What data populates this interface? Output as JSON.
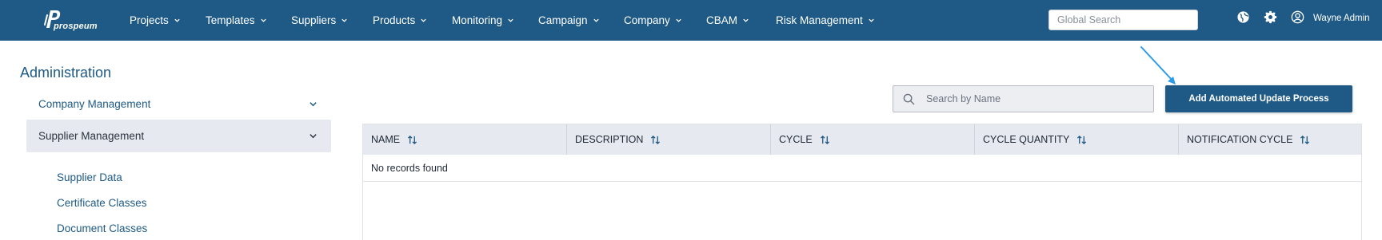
{
  "app": {
    "logo_text": "prospeum"
  },
  "nav": {
    "items": [
      {
        "label": "Projects"
      },
      {
        "label": "Templates"
      },
      {
        "label": "Suppliers"
      },
      {
        "label": "Products"
      },
      {
        "label": "Monitoring"
      },
      {
        "label": "Campaign"
      },
      {
        "label": "Company"
      },
      {
        "label": "CBAM"
      },
      {
        "label": "Risk Management"
      }
    ],
    "global_search_placeholder": "Global Search",
    "icons": [
      "globe-icon",
      "gear-icon",
      "user-circle-icon"
    ],
    "user_name": "Wayne Admin"
  },
  "sidebar": {
    "title": "Administration",
    "sections": [
      {
        "label": "Company Management",
        "expanded": false
      },
      {
        "label": "Supplier Management",
        "expanded": true
      }
    ],
    "sub_items": [
      {
        "label": "Supplier Data"
      },
      {
        "label": "Certificate Classes"
      },
      {
        "label": "Document Classes"
      }
    ]
  },
  "toolbar": {
    "search_placeholder": "Search by Name",
    "add_button_label": "Add Automated Update Process"
  },
  "table": {
    "columns": [
      {
        "label": "NAME"
      },
      {
        "label": "DESCRIPTION"
      },
      {
        "label": "CYCLE"
      },
      {
        "label": "CYCLE QUANTITY"
      },
      {
        "label": "NOTIFICATION CYCLE"
      }
    ],
    "empty_message": "No records found"
  },
  "colors": {
    "brand": "#1e5a85",
    "header_bg": "#e6e9ef",
    "annotation_arrow": "#2b9be8"
  }
}
